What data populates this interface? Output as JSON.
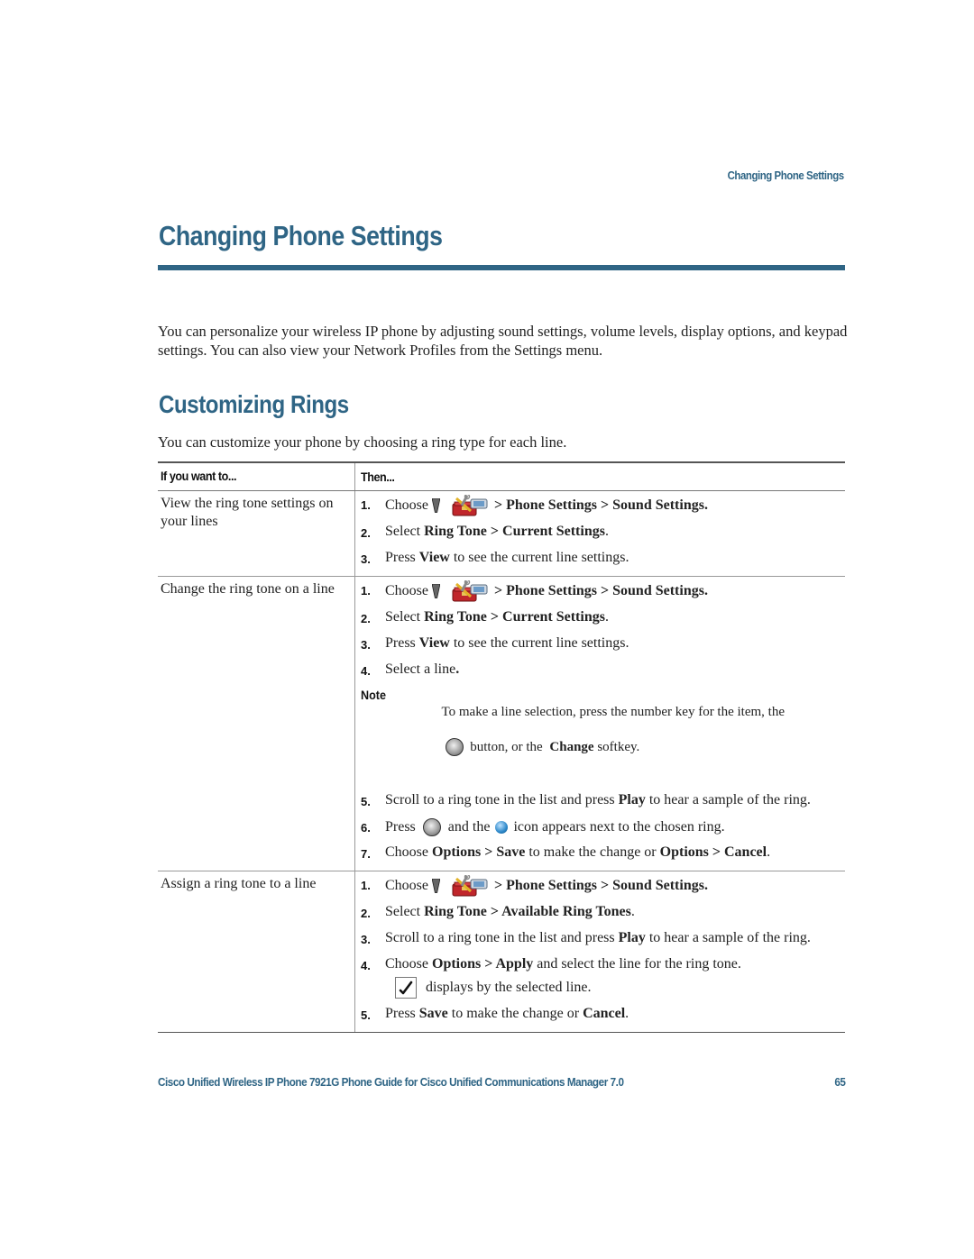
{
  "running_header": "Changing Phone Settings",
  "page_title": "Changing Phone Settings",
  "intro": "You can personalize your wireless IP phone by adjusting sound settings, volume levels, display options, and keypad settings. You can also view your Network Profiles from the Settings menu.",
  "section": {
    "title": "Customizing Rings",
    "intro": "You can customize your phone by choosing a ring type for each line."
  },
  "table": {
    "headers": [
      "If you want to...",
      "Then..."
    ],
    "rows": [
      {
        "task": "View the ring tone settings on your lines",
        "steps": {
          "s1": {
            "num": "1.",
            "pre": "Choose",
            "path": "> Phone Settings > Sound Settings."
          },
          "s2": {
            "num": "2.",
            "pre": "Select ",
            "bold": "Ring Tone > Current Settings",
            "post": "."
          },
          "s3": {
            "num": "3.",
            "pre": "Press ",
            "bold": "View",
            "post": " to see the current line settings."
          }
        }
      },
      {
        "task": "Change the ring tone on a line",
        "steps": {
          "s1": {
            "num": "1.",
            "pre": "Choose",
            "path": "> Phone Settings > Sound Settings."
          },
          "s2": {
            "num": "2.",
            "pre": "Select ",
            "bold": "Ring Tone > Current Settings",
            "post": "."
          },
          "s3": {
            "num": "3.",
            "pre": "Press ",
            "bold": "View",
            "post": " to see the current line settings."
          },
          "s4": {
            "num": "4.",
            "pre": "Select a line",
            "post": "."
          },
          "note": {
            "label": "Note",
            "line1": "To make a line selection, press the number key for the item, the",
            "line2_pre": " button, or the ",
            "line2_bold": "Change",
            "line2_post": " softkey."
          },
          "s5": {
            "num": "5.",
            "pre": "Scroll to a ring tone in the list and press ",
            "bold": "Play",
            "post": " to hear a sample of the ring."
          },
          "s6": {
            "num": "6.",
            "pre": "Press",
            "mid": "and the",
            "post": "icon appears next to the chosen ring."
          },
          "s7": {
            "num": "7.",
            "pre": "Choose ",
            "bold1": "Options > Save",
            "mid": " to make the change or ",
            "bold2": "Options > Cancel",
            "post": "."
          }
        }
      },
      {
        "task": "Assign a ring tone to a line",
        "steps": {
          "s1": {
            "num": "1.",
            "pre": "Choose",
            "path": "> Phone Settings > Sound Settings."
          },
          "s2": {
            "num": "2.",
            "pre": "Select ",
            "bold": "Ring Tone > Available Ring Tones",
            "post": "."
          },
          "s3": {
            "num": "3.",
            "pre": "Scroll to a ring tone in the list and press ",
            "bold": "Play",
            "post": " to hear a sample of the ring."
          },
          "s4": {
            "num": "4.",
            "pre": "Choose ",
            "bold": "Options > Apply",
            "post": " and select the line for the ring tone."
          },
          "s4_sub": "displays by the selected line.",
          "s5": {
            "num": "5.",
            "pre": "Press ",
            "bold1": "Save",
            "mid": " to make the change or ",
            "bold2": "Cancel",
            "post": "."
          }
        }
      }
    ]
  },
  "icons": {
    "nav_arrow": "navigation-down-arrow-icon",
    "settings": "toolbox-settings-icon",
    "select_button": "select-button-icon",
    "selected_ring": "blue-dot-icon",
    "checkmark": "checkmark-icon"
  },
  "footer": {
    "title": "Cisco Unified Wireless IP Phone 7921G Phone Guide for Cisco Unified Communications Manager 7.0",
    "page_number": "65"
  },
  "colors": {
    "accent": "#2f6585"
  }
}
